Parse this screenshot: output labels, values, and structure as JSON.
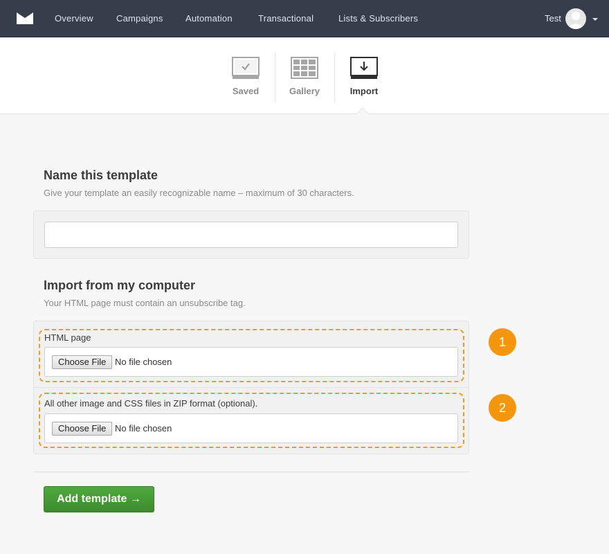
{
  "nav": {
    "items": [
      "Overview",
      "Campaigns",
      "Automation",
      "Transactional",
      "Lists & Subscribers"
    ],
    "user_name": "Test"
  },
  "tabs": [
    {
      "label": "Saved",
      "icon": "saved-templates-icon",
      "active": false
    },
    {
      "label": "Gallery",
      "icon": "gallery-grid-icon",
      "active": false
    },
    {
      "label": "Import",
      "icon": "import-download-icon",
      "active": true
    }
  ],
  "name_section": {
    "title": "Name this template",
    "description": "Give your template an easily recognizable name – maximum of 30 characters.",
    "input_value": ""
  },
  "import_section": {
    "title": "Import from my computer",
    "description": "Your HTML page must contain an unsubscribe tag.",
    "fields": [
      {
        "label": "HTML page",
        "button": "Choose File",
        "status": "No file chosen",
        "step": "1"
      },
      {
        "label": "All other image and CSS files in ZIP format (optional).",
        "button": "Choose File",
        "status": "No file chosen",
        "step": "2"
      }
    ]
  },
  "submit_label": "Add template →",
  "colors": {
    "nav_bg": "#363d4b",
    "accent_orange": "#f5960f",
    "submit_green": "#44993a"
  }
}
